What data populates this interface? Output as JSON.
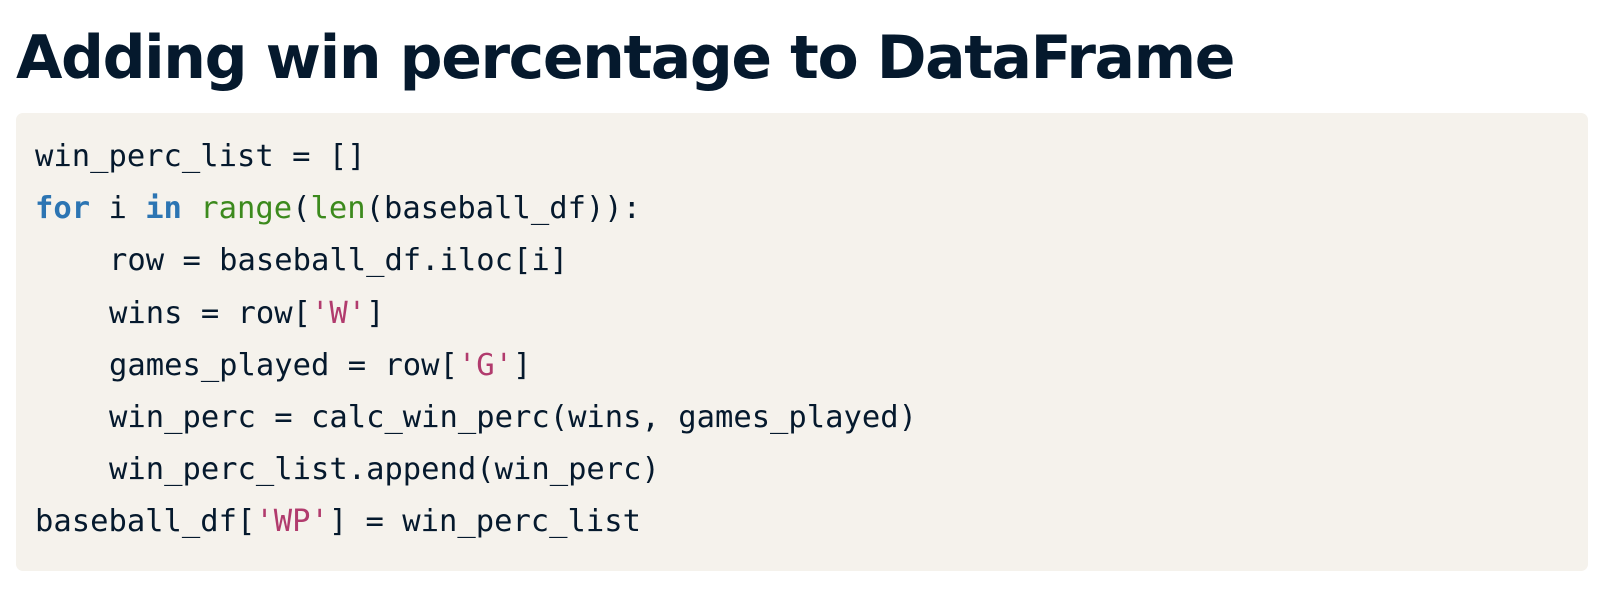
{
  "page": {
    "title": "Adding win percentage to DataFrame"
  },
  "code": {
    "language": "python",
    "colors": {
      "text": "#05192d",
      "keyword": "#2c75b3",
      "builtin": "#3c8a1d",
      "string": "#b13b6d",
      "background": "#f5f2ec"
    },
    "lines": [
      {
        "indent": 0,
        "tokens": [
          {
            "type": "text",
            "text": "win_perc_list = []"
          }
        ]
      },
      {
        "indent": 0,
        "tokens": [
          {
            "type": "keyword",
            "text": "for"
          },
          {
            "type": "text",
            "text": " i "
          },
          {
            "type": "keyword",
            "text": "in"
          },
          {
            "type": "text",
            "text": " "
          },
          {
            "type": "builtin",
            "text": "range"
          },
          {
            "type": "text",
            "text": "("
          },
          {
            "type": "builtin",
            "text": "len"
          },
          {
            "type": "text",
            "text": "(baseball_df)):"
          }
        ]
      },
      {
        "indent": 1,
        "tokens": [
          {
            "type": "text",
            "text": "row = baseball_df.iloc[i]"
          }
        ]
      },
      {
        "indent": 1,
        "tokens": [
          {
            "type": "text",
            "text": "wins = row["
          },
          {
            "type": "string",
            "text": "'W'"
          },
          {
            "type": "text",
            "text": "]"
          }
        ]
      },
      {
        "indent": 1,
        "tokens": [
          {
            "type": "text",
            "text": "games_played = row["
          },
          {
            "type": "string",
            "text": "'G'"
          },
          {
            "type": "text",
            "text": "]"
          }
        ]
      },
      {
        "indent": 1,
        "tokens": [
          {
            "type": "text",
            "text": "win_perc = calc_win_perc(wins, games_played)"
          }
        ]
      },
      {
        "indent": 1,
        "tokens": [
          {
            "type": "text",
            "text": "win_perc_list.append(win_perc)"
          }
        ]
      },
      {
        "indent": 0,
        "tokens": [
          {
            "type": "text",
            "text": "baseball_df["
          },
          {
            "type": "string",
            "text": "'WP'"
          },
          {
            "type": "text",
            "text": "] = win_perc_list"
          }
        ]
      }
    ]
  }
}
